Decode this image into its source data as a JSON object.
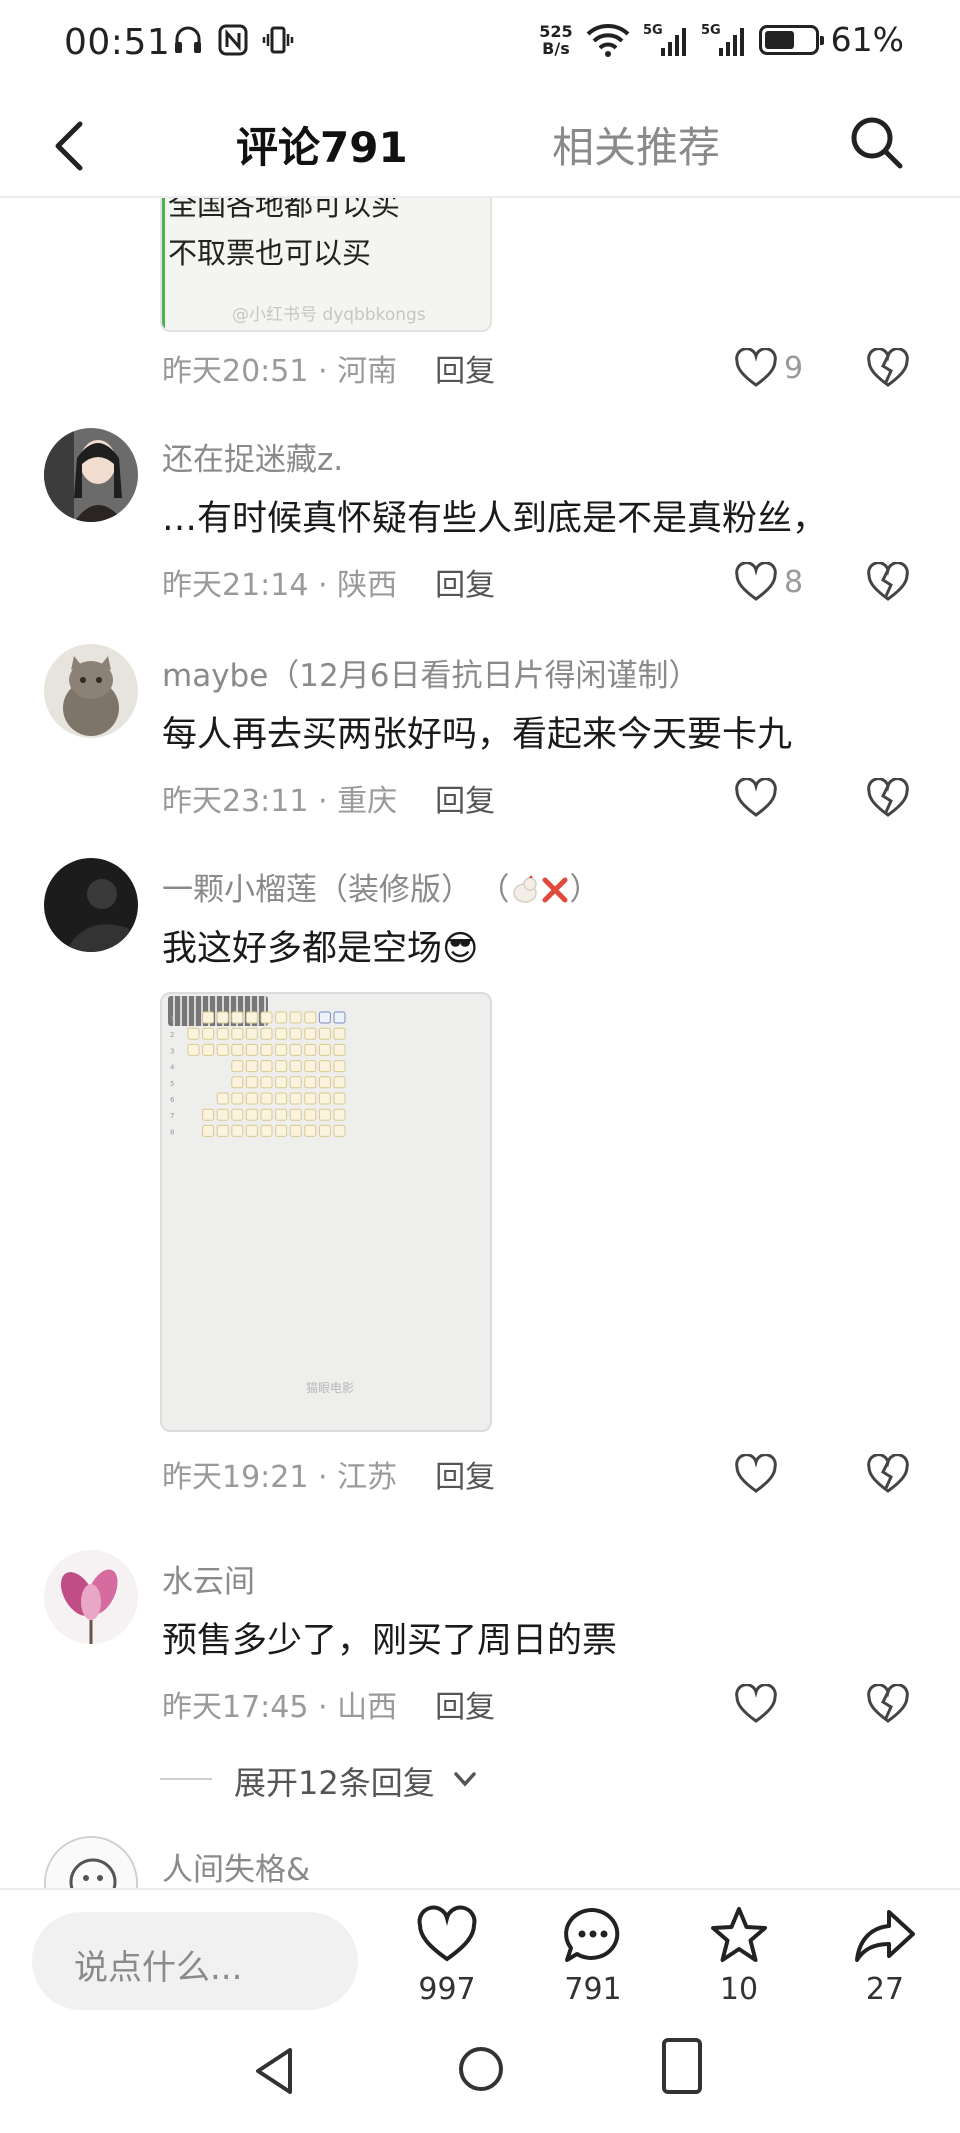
{
  "status_bar": {
    "time": "00:51",
    "net_speed_value": "525",
    "net_speed_unit": "B/s",
    "battery": "61%",
    "battery_level": 0.61,
    "icons": [
      "headset-icon",
      "nfc-icon",
      "vibrate-icon",
      "wifi-icon",
      "signal-5g-icon",
      "signal-5g-icon",
      "battery-icon"
    ]
  },
  "header": {
    "tab_comments": "评论791",
    "tab_related": "相关推荐"
  },
  "image_fragment": {
    "line1": "全国各地都可以买",
    "line2": "不取票也可以买",
    "watermark": "@小红书号 dyqbbkongs"
  },
  "comments": [
    {
      "meta_time": "昨天20:51",
      "meta_location": "河南",
      "reply": "回复",
      "likes": "9"
    },
    {
      "name": "还在捉迷藏z.",
      "text": "…有时候真怀疑有些人到底是不是真粉丝，",
      "meta_time": "昨天21:14",
      "meta_location": "陕西",
      "reply": "回复",
      "likes": "8"
    },
    {
      "name": "maybe（12月6日看抗日片得闲谨制）",
      "text": "每人再去买两张好吗，看起来今天要卡九",
      "meta_time": "昨天23:11",
      "meta_location": "重庆",
      "reply": "回复",
      "likes": ""
    },
    {
      "name": "一颗小榴莲（装修版）",
      "name_suffix": "（",
      "name_suffix_end": "）",
      "text": "我这好多都是空场😎",
      "seat_logo": "猫眼电影",
      "meta_time": "昨天19:21",
      "meta_location": "江苏",
      "reply": "回复",
      "likes": ""
    },
    {
      "name": "水云间",
      "text": "预售多少了，刚买了周日的票",
      "meta_time": "昨天17:45",
      "meta_location": "山西",
      "reply": "回复",
      "likes": "",
      "expand": "展开12条回复"
    },
    {
      "name": "人间失格&"
    }
  ],
  "bottom_bar": {
    "input_placeholder": "说点什么...",
    "like_count": "997",
    "comment_count": "791",
    "star_count": "10",
    "share_count": "27"
  },
  "colors": {
    "text_primary": "#1a1a1a",
    "text_secondary": "#8a8a8a",
    "divider": "#ececec",
    "seat_fill": "#fbf3dd",
    "seat_border": "#d9c98f",
    "seat_blue": "#7a8ebd"
  }
}
